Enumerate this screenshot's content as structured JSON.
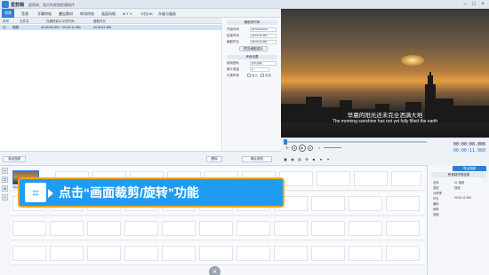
{
  "app": {
    "title": "爱剪辑",
    "subtitle": "超简单、强大的视频剪辑软件"
  },
  "menu": [
    "视频",
    "音频",
    "字幕特效",
    "叠加素材",
    "转场特效",
    "画面风格",
    "M T V",
    "卡拉OK",
    "升级与服务"
  ],
  "file_list": {
    "columns": [
      "序号",
      "文件名",
      "在最终影片中的时间",
      "截取时长"
    ],
    "rows": [
      {
        "index": "01",
        "name": "视频",
        "time": "00:00:00.000 ~ 00:00:11.960",
        "duration": "00:00:11.960"
      }
    ],
    "add_button": "添加视频",
    "delete_button": "删除",
    "confirm_button": "确认修改"
  },
  "clip_panel": {
    "section1": "截取的时间",
    "start_label": "开始时间",
    "start_value": "00:00:00.000",
    "end_label": "结束时间",
    "end_value": "00:00:11.960",
    "duration_label": "截取时长",
    "duration_value": "00:00:11.960",
    "preview_button": "预览/截取原片",
    "section2": "声音设置",
    "track_label": "使用音轨",
    "track_value": "原片音轨",
    "volume_label": "原片音量",
    "volume_value": "0",
    "fade_label": "头尾声音",
    "fade_in": "淡入",
    "fade_out": "淡出"
  },
  "preview": {
    "caption_cn": "早晨的阳光还未完全洒满大地",
    "caption_en": "The morning sunshine has not yet fully filled the earth"
  },
  "transport": {
    "current_time": "00:00:00.000",
    "total_time": "00:00:11.960"
  },
  "timeline": {
    "clip_label": "视频"
  },
  "callout": {
    "text": "点击“画面裁剪/旋转”功能"
  },
  "properties": {
    "export_button": "导出视频",
    "header": "所有制作的信息",
    "rows": [
      {
        "label": "名称",
        "value": "01 视频"
      },
      {
        "label": "类型",
        "value": "视频"
      },
      {
        "label": "分辨率",
        "value": ""
      },
      {
        "label": "时长",
        "value": "00:00:11.960"
      },
      {
        "label": "编码",
        "value": ""
      },
      {
        "label": "帧率",
        "value": ""
      },
      {
        "label": "音频",
        "value": ""
      }
    ]
  }
}
